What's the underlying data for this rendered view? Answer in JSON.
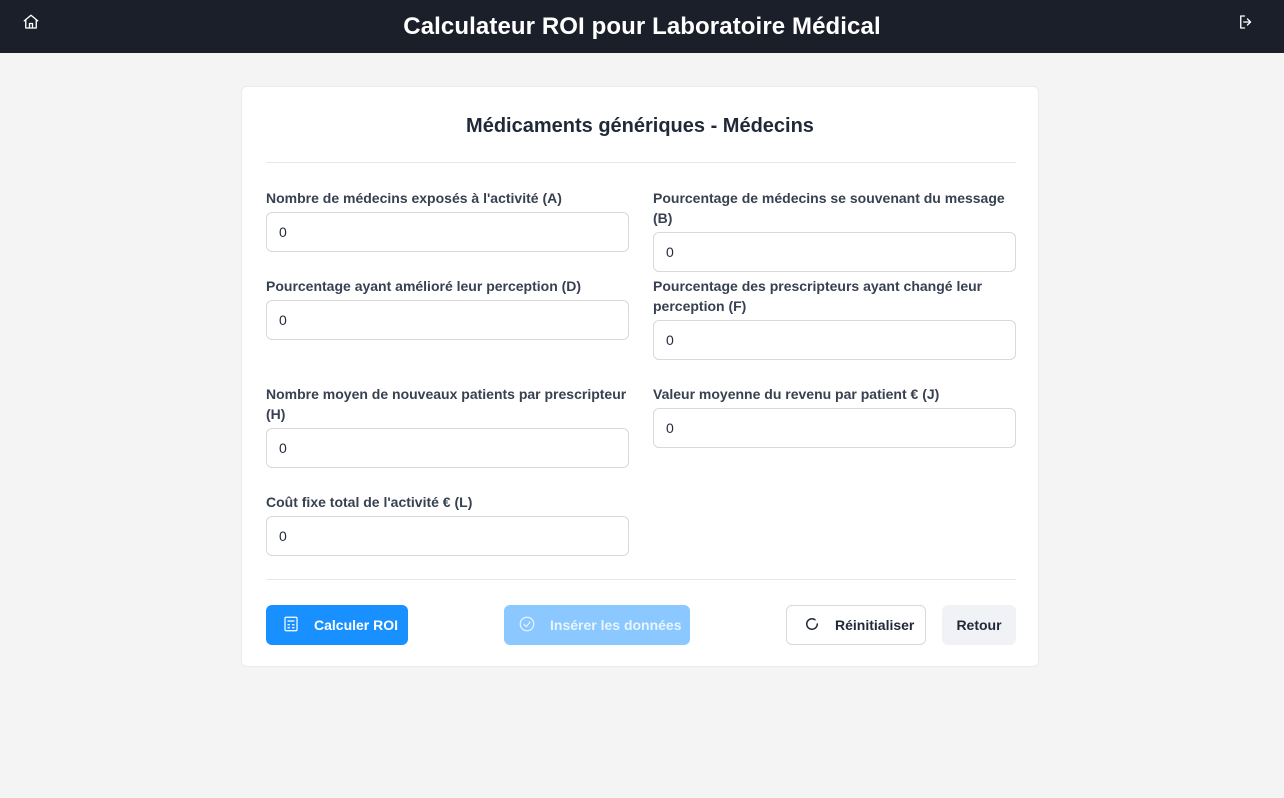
{
  "header": {
    "title": "Calculateur ROI pour Laboratoire Médical",
    "home_icon": "home-icon",
    "logout_icon": "logout-icon"
  },
  "card": {
    "title": "Médicaments génériques - Médecins"
  },
  "fields": [
    {
      "label": "Nombre de médecins exposés à l'activité (A)",
      "value": "0"
    },
    {
      "label": "Pourcentage de médecins se souvenant du message (B)",
      "value": "0"
    },
    {
      "label": "Pourcentage ayant amélioré leur perception (D)",
      "value": "0"
    },
    {
      "label": "Pourcentage des prescripteurs ayant changé leur perception (F)",
      "value": "0"
    },
    {
      "label": "Nombre moyen de nouveaux patients par prescripteur (H)",
      "value": "0"
    },
    {
      "label": "Valeur moyenne du revenu par patient € (J)",
      "value": "0"
    },
    {
      "label": "Coût fixe total de l'activité € (L)",
      "value": "0"
    }
  ],
  "actions": {
    "calculate_label": "Calculer ROI",
    "insert_label": "Insérer les données",
    "reset_label": "Réinitialiser",
    "back_label": "Retour"
  },
  "colors": {
    "header_bg": "#1b1f2a",
    "primary": "#1890ff",
    "primary_disabled": "#8ac8ff",
    "page_bg": "#f4f4f5"
  }
}
